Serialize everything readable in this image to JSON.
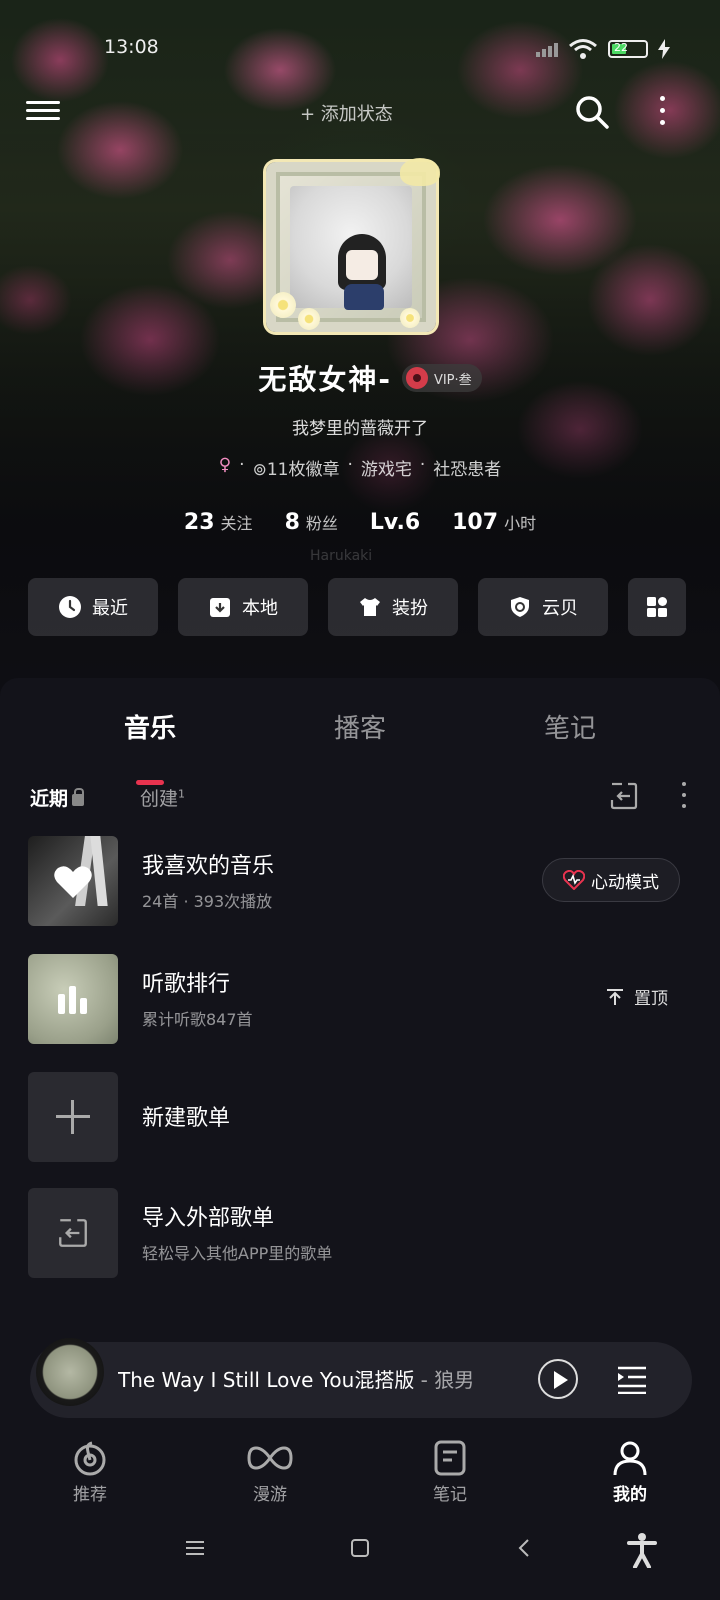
{
  "status_bar": {
    "time": "13:08",
    "battery_level": "22"
  },
  "top_bar": {
    "add_status": "+ 添加状态"
  },
  "profile": {
    "username": "无敌女神-",
    "vip_label": "VIP·叁",
    "signature": "我梦里的蔷薇开了",
    "tags": [
      "·",
      "⊚11枚徽章",
      "·",
      "游戏宅",
      "·",
      "社恐患者"
    ],
    "stats": [
      {
        "num": "23",
        "label": "关注"
      },
      {
        "num": "8",
        "label": "粉丝"
      },
      {
        "num": "Lv.6",
        "label": ""
      },
      {
        "num": "107",
        "label": "小时"
      }
    ],
    "watermark": "Harukaki"
  },
  "quick_actions": [
    {
      "label": "最近",
      "icon": "clock-icon"
    },
    {
      "label": "本地",
      "icon": "download-box-icon"
    },
    {
      "label": "装扮",
      "icon": "shirt-icon"
    },
    {
      "label": "云贝",
      "icon": "shield-coin-icon"
    }
  ],
  "tabs": [
    "音乐",
    "播客",
    "笔记"
  ],
  "subtabs": {
    "recent": "近期",
    "create": "创建",
    "create_count": "1"
  },
  "list": [
    {
      "title": "我喜欢的音乐",
      "sub": "24首 · 393次播放",
      "action": "心动模式"
    },
    {
      "title": "听歌排行",
      "sub": "累计听歌847首",
      "action": "置顶"
    },
    {
      "title": "新建歌单"
    },
    {
      "title": "导入外部歌单",
      "sub": "轻松导入其他APP里的歌单"
    }
  ],
  "player": {
    "song": "The Way I Still Love You混搭版",
    "artist": " - 狼男"
  },
  "nav": [
    {
      "label": "推荐",
      "icon": "netease-logo-icon"
    },
    {
      "label": "漫游",
      "icon": "infinity-icon"
    },
    {
      "label": "笔记",
      "icon": "note-icon"
    },
    {
      "label": "我的",
      "icon": "person-icon"
    }
  ],
  "colors": {
    "accent": "#e8334f",
    "background": "#13131a"
  }
}
